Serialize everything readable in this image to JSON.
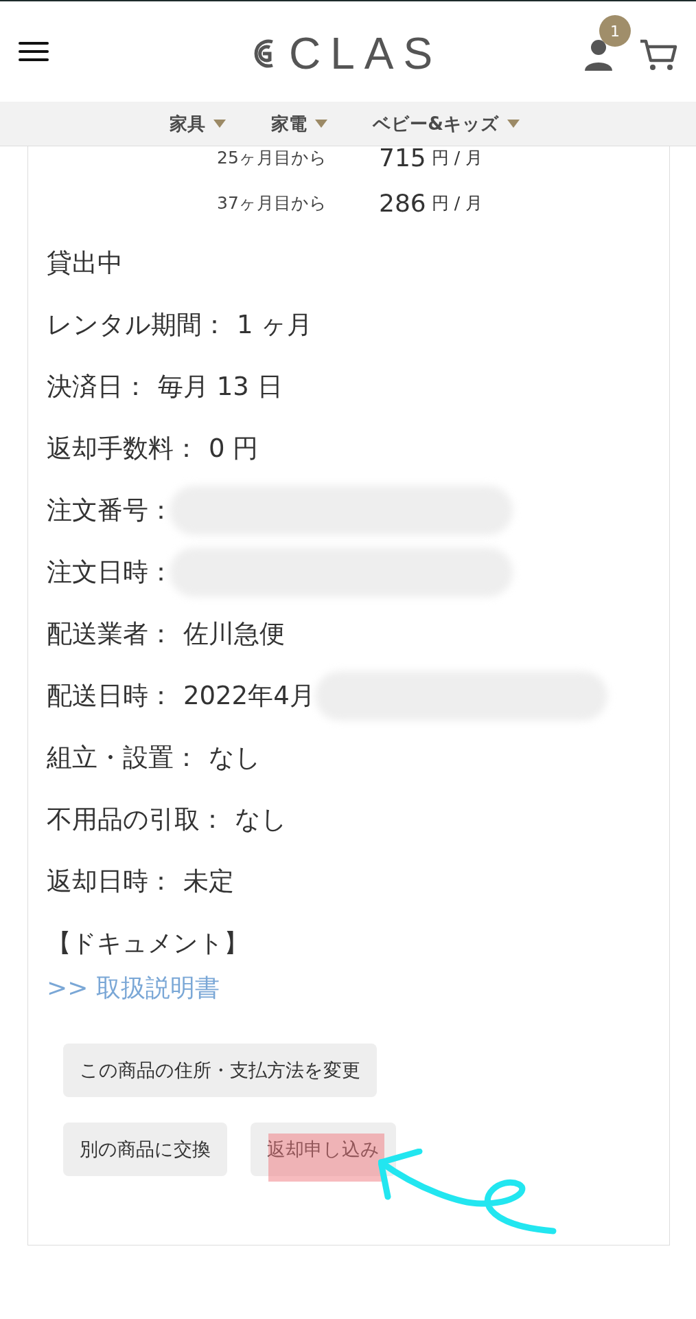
{
  "header": {
    "logo": "CLAS",
    "cart_badge": "1"
  },
  "nav": [
    {
      "label": "家具"
    },
    {
      "label": "家電"
    },
    {
      "label": "ベビー&キッズ"
    }
  ],
  "price_rows": [
    {
      "from": "25ヶ月目から",
      "amount": "715",
      "unit": "円 / 月"
    },
    {
      "from": "37ヶ月目から",
      "amount": "286",
      "unit": "円 / 月"
    }
  ],
  "details": [
    {
      "label": "貸出中"
    },
    {
      "label": "レンタル期間：",
      "value": "1 ヶ月"
    },
    {
      "label": "決済日：",
      "value": "毎月 13 日"
    },
    {
      "label": "返却手数料：",
      "value": "0 円"
    },
    {
      "label": "注文番号：",
      "redacted": true
    },
    {
      "label": "注文日時：",
      "redacted": true
    },
    {
      "label": "配送業者：",
      "value": "佐川急便"
    },
    {
      "label": "配送日時：",
      "value": "2022年4月",
      "redacted": true
    },
    {
      "label": "組立・設置：",
      "value": "なし"
    },
    {
      "label": "不用品の引取：",
      "value": "なし"
    },
    {
      "label": "返却日時：",
      "value": "未定"
    }
  ],
  "documents": {
    "heading": "【ドキュメント】",
    "link": ">> 取扱説明書"
  },
  "buttons": [
    [
      {
        "label": "この商品の住所・支払方法を変更",
        "highlighted": false
      }
    ],
    [
      {
        "label": "別の商品に交換",
        "highlighted": false
      },
      {
        "label": "返却申し込み",
        "highlighted": true
      }
    ]
  ]
}
